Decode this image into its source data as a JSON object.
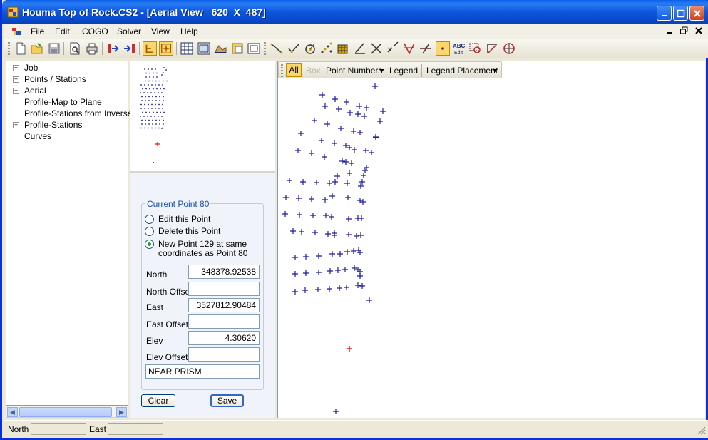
{
  "window": {
    "title": "Houma Top of Rock.CS2 - [Aerial View   620  X  487]"
  },
  "menu": [
    "File",
    "Edit",
    "COGO",
    "Solver",
    "View",
    "Help"
  ],
  "tree": [
    {
      "label": "Job",
      "expandable": true
    },
    {
      "label": "Points / Stations",
      "expandable": true
    },
    {
      "label": "Aerial",
      "expandable": true
    },
    {
      "label": "Profile-Map to Plane",
      "expandable": false
    },
    {
      "label": "Profile-Stations from Inverse",
      "expandable": false
    },
    {
      "label": "Profile-Stations",
      "expandable": true
    },
    {
      "label": "Curves",
      "expandable": false
    }
  ],
  "point_form": {
    "group_title": "Current Point 80",
    "options": [
      {
        "label": "Edit this Point",
        "selected": false
      },
      {
        "label": "Delete this Point",
        "selected": false
      },
      {
        "label_line1": "New Point 129 at same",
        "label_line2": "coordinates as Point 80",
        "selected": true
      }
    ],
    "north_label": "North",
    "north_value": "348378.92538",
    "north_offset_label": "North Offset",
    "north_offset_value": "",
    "east_label": "East",
    "east_value": "3527812.90484",
    "east_offset_label": "East Offset",
    "east_offset_value": "",
    "elev_label": "Elev",
    "elev_value": "4.30620",
    "elev_offset_label": "Elev Offset",
    "elev_offset_value": "",
    "description": "NEAR PRISM",
    "clear_label": "Clear",
    "save_label": "Save"
  },
  "map_toolbar": {
    "all_label": "All",
    "box_label": "Box",
    "point_numbers_label": "Point Numbers",
    "legend_label": "Legend",
    "legend_placement_label": "Legend Placement"
  },
  "status": {
    "north_label": "North",
    "north_value": "",
    "east_label": "East",
    "east_value": ""
  },
  "colors": {
    "point_marker": "#1a1aa8",
    "current_point_marker": "#e01010",
    "title_bar": "#0a5fe8"
  }
}
